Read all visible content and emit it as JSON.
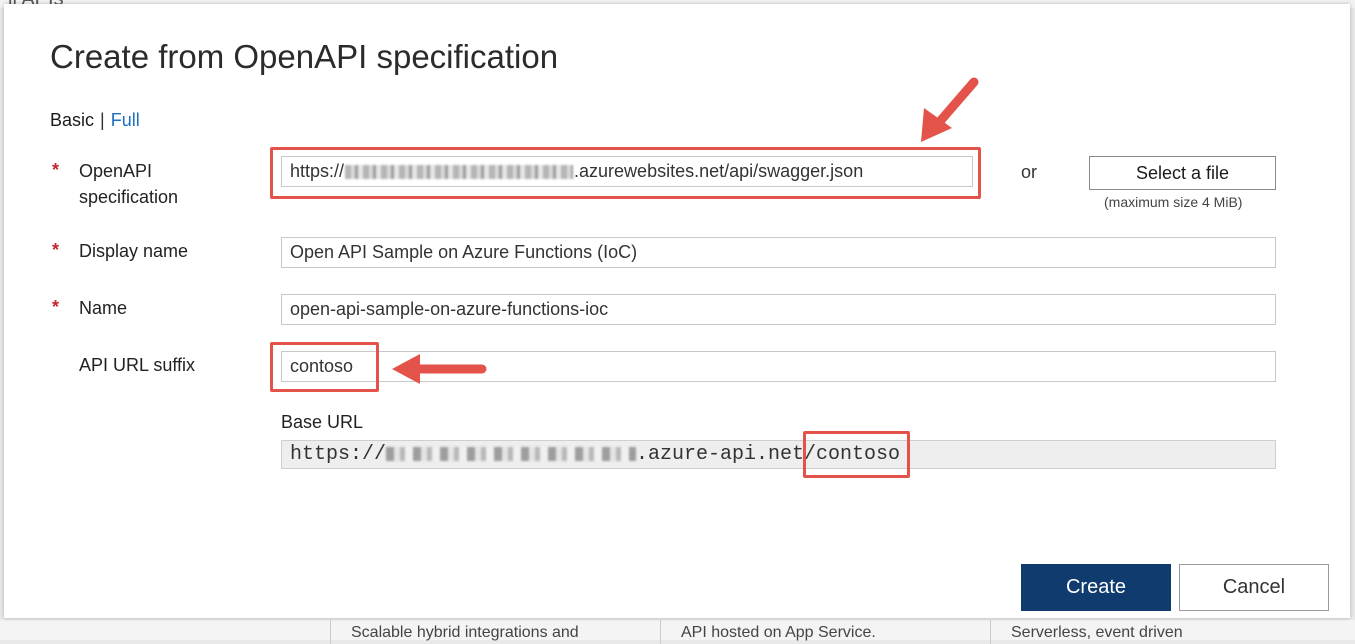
{
  "background": {
    "top_text": "ll APIs",
    "cards": [
      "Scalable hybrid integrations and",
      "API hosted on App Service.",
      "Serverless, event driven"
    ]
  },
  "dialog": {
    "title": "Create from OpenAPI specification",
    "mode": {
      "basic": "Basic",
      "separator": "|",
      "full": "Full"
    },
    "fields": {
      "openapi": {
        "label_line1": "OpenAPI",
        "label_line2": "specification",
        "required": "*",
        "value_prefix": "https://",
        "value_suffix": ".azurewebsites.net/api/swagger.json"
      },
      "display_name": {
        "label": "Display name",
        "required": "*",
        "value": "Open API Sample on Azure Functions (IoC)"
      },
      "name": {
        "label": "Name",
        "required": "*",
        "value": "open-api-sample-on-azure-functions-ioc"
      },
      "api_url_suffix": {
        "label": "API URL suffix",
        "value": "contoso"
      }
    },
    "or_text": "or",
    "select_file": "Select a file",
    "max_size_note": "(maximum size 4 MiB)",
    "base_url": {
      "label": "Base URL",
      "prefix": "https://",
      "domain": ".azure-api.net/",
      "suffix": "contoso"
    },
    "buttons": {
      "create": "Create",
      "cancel": "Cancel"
    }
  },
  "colors": {
    "accent": "#0f3b6e",
    "link": "#1f6fc1",
    "required": "#c4262e",
    "annotation": "#e4534a"
  }
}
